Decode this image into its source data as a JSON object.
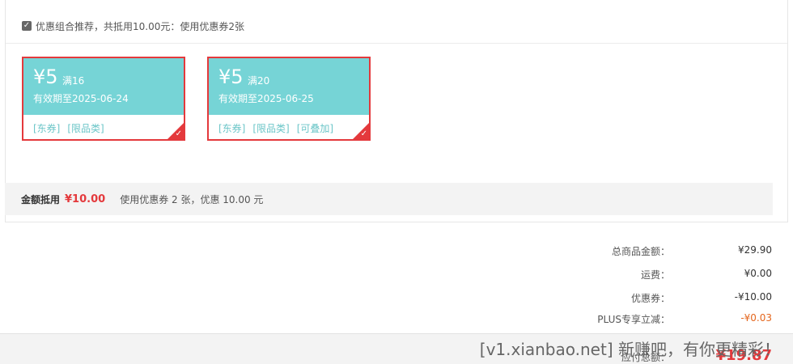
{
  "coupon_section": {
    "combo_text": "优惠组合推荐，共抵用10.00元：使用优惠券2张",
    "coupons": [
      {
        "amount": "¥5",
        "condition": "满16",
        "validity": "有效期至2025-06-24",
        "tags": [
          "[东券]",
          "[限品类]"
        ],
        "selected": true
      },
      {
        "amount": "¥5",
        "condition": "满20",
        "validity": "有效期至2025-06-25",
        "tags": [
          "[东券]",
          "[限品类]",
          "[可叠加]"
        ],
        "selected": true
      }
    ],
    "discount_label": "金额抵用",
    "discount_amount": "¥10.00",
    "discount_desc": "使用优惠券 2 张，优惠 10.00 元"
  },
  "summary": {
    "rows": [
      {
        "label": "总商品金额：",
        "value": "¥29.90"
      },
      {
        "label": "运费：",
        "value": "¥0.00"
      },
      {
        "label": "优惠券：",
        "value": "-¥10.00"
      },
      {
        "label": "PLUS专享立减：",
        "value": "-¥0.03"
      }
    ],
    "total_label": "应付总额：",
    "total_value": "¥19.87"
  },
  "watermark": "[v1.xianbao.net] 新赚吧，有你更精彩！",
  "colors": {
    "accent": "#e4393c",
    "coupon_teal": "#76d4d6",
    "plus_orange": "#e4661d"
  }
}
